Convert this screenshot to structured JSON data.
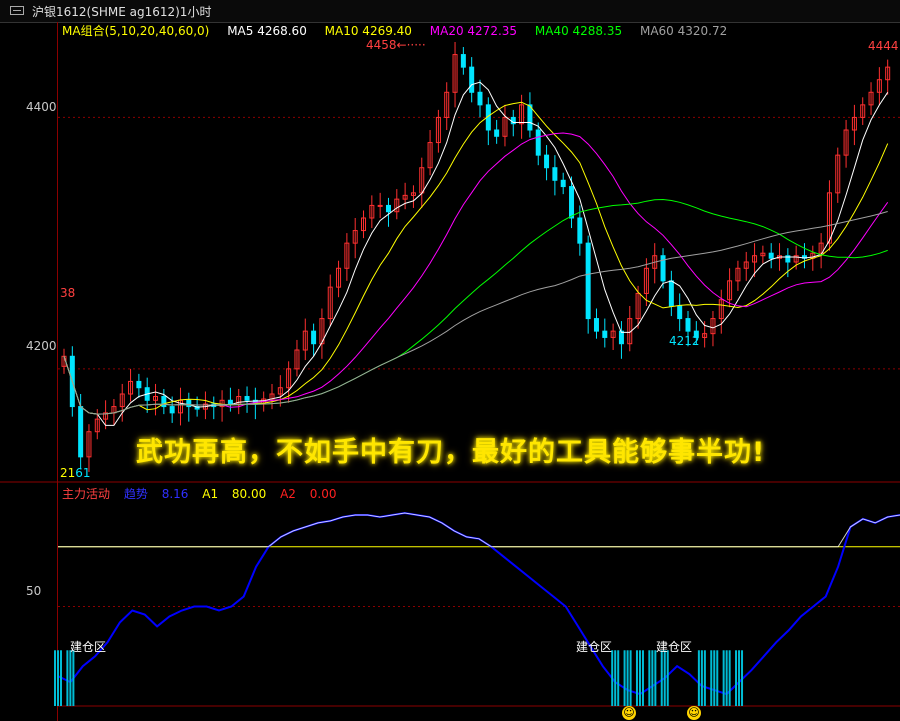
{
  "window": {
    "title": "沪银1612(SHME ag1612)1小时"
  },
  "price_axis": {
    "labels": [
      "4400",
      "4200"
    ],
    "values": [
      4400,
      4200
    ]
  },
  "indicator_axis": {
    "labels": [
      "50"
    ],
    "values": [
      50
    ]
  },
  "ma_legend": {
    "group": "MA组合(5,10,20,40,60,0)",
    "ma5": "MA5 4268.60",
    "ma10": "MA10 4269.40",
    "ma20": "MA20 4272.35",
    "ma40": "MA40 4288.35",
    "ma60": "MA60 4320.72"
  },
  "annotations": {
    "high_left": "4458",
    "high_right": "4444",
    "low_mid": "4212",
    "left_edge": "38",
    "left_bottom": "21",
    "left_bottom2": "61"
  },
  "slogan": "武功再高，不如手中有刀，最好的工具能够事半功!",
  "indicator": {
    "name": "主力活动",
    "trend": "趋势",
    "trend_value": "8.16",
    "a1": "A1",
    "a1_value": "80.00",
    "a2": "A2",
    "a2_value": "0.00",
    "zone_label": "建仓区"
  },
  "colors": {
    "up": "#ff3030",
    "down": "#00e5ff",
    "ma5": "#ffffff",
    "ma10": "#ffff00",
    "ma20": "#ff00ff",
    "ma40": "#00ff00",
    "ma60": "#a0a0a0",
    "trend": "#0000ff",
    "a1": "#ffff00",
    "a2": "#ff0000",
    "grid": "#8b0000"
  },
  "chart_data": {
    "type": "candlestick",
    "price_ylim": [
      4110,
      4460
    ],
    "close": [
      4210,
      4170,
      4130,
      4150,
      4160,
      4165,
      4170,
      4180,
      4190,
      4185,
      4175,
      4178,
      4170,
      4165,
      4175,
      4170,
      4168,
      4172,
      4170,
      4175,
      4172,
      4178,
      4175,
      4172,
      4176,
      4180,
      4185,
      4200,
      4215,
      4230,
      4220,
      4240,
      4265,
      4280,
      4300,
      4310,
      4320,
      4330,
      4330,
      4325,
      4335,
      4338,
      4340,
      4360,
      4380,
      4400,
      4420,
      4450,
      4440,
      4420,
      4410,
      4390,
      4385,
      4400,
      4395,
      4410,
      4390,
      4370,
      4360,
      4350,
      4345,
      4320,
      4300,
      4240,
      4230,
      4225,
      4230,
      4220,
      4240,
      4260,
      4280,
      4290,
      4270,
      4250,
      4240,
      4230,
      4225,
      4228,
      4240,
      4255,
      4270,
      4280,
      4285,
      4290,
      4292,
      4288,
      4290,
      4285,
      4290,
      4288,
      4292,
      4300,
      4340,
      4370,
      4390,
      4400,
      4410,
      4420,
      4430,
      4440
    ],
    "indicator_ylim": [
      0,
      100
    ],
    "trend": [
      15,
      12,
      20,
      25,
      32,
      42,
      48,
      46,
      40,
      45,
      48,
      50,
      50,
      48,
      50,
      55,
      70,
      80,
      85,
      88,
      90,
      92,
      93,
      95,
      96,
      96,
      95,
      96,
      97,
      96,
      95,
      92,
      88,
      85,
      84,
      80,
      75,
      70,
      65,
      60,
      55,
      50,
      40,
      30,
      20,
      12,
      8,
      6,
      10,
      14,
      20,
      16,
      10,
      8,
      6,
      12,
      18,
      25,
      32,
      38,
      45,
      50,
      55,
      70,
      90,
      94,
      92,
      95,
      96
    ],
    "a1": 80,
    "a2": 0,
    "series": [
      {
        "name": "MA5"
      },
      {
        "name": "MA10"
      },
      {
        "name": "MA20"
      },
      {
        "name": "MA40"
      },
      {
        "name": "MA60"
      }
    ]
  }
}
